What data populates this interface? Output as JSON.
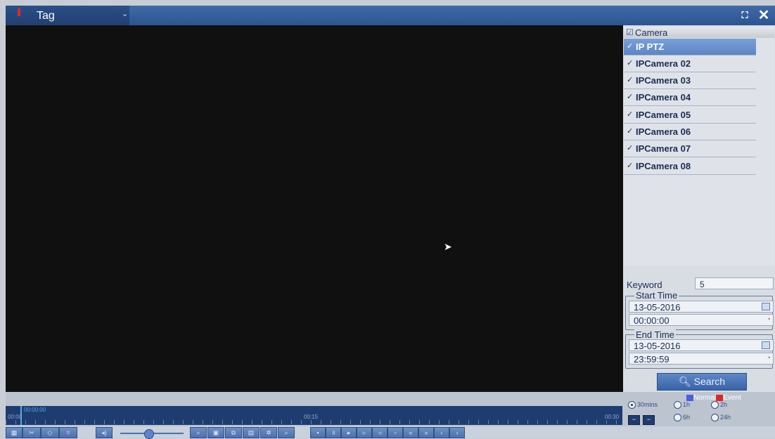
{
  "header": {
    "mode_label": "Tag",
    "fullscreen_icon": "fullscreen-icon",
    "close_icon": "close-icon"
  },
  "camera_list": {
    "header_label": "Camera",
    "items": [
      {
        "label": "IP PTZ",
        "checked": true,
        "selected": true
      },
      {
        "label": "IPCamera 02",
        "checked": true,
        "selected": false
      },
      {
        "label": "IPCamera 03",
        "checked": true,
        "selected": false
      },
      {
        "label": "IPCamera 04",
        "checked": true,
        "selected": false
      },
      {
        "label": "IPCamera 05",
        "checked": true,
        "selected": false
      },
      {
        "label": "IPCamera 06",
        "checked": true,
        "selected": false
      },
      {
        "label": "IPCamera 07",
        "checked": true,
        "selected": false
      },
      {
        "label": "IPCamera 08",
        "checked": true,
        "selected": false
      }
    ]
  },
  "search_panel": {
    "keyword_label": "Keyword",
    "keyword_value": "5",
    "start_time_label": "Start Time",
    "start_date": "13-05-2016",
    "start_time": "00:00:00",
    "end_time_label": "End Time",
    "end_date": "13-05-2016",
    "end_time": "23:59:59",
    "search_button": "Search"
  },
  "legend": {
    "normal_label": "Normal",
    "event_label": "Event",
    "normal_color": "#4a5fe0",
    "event_color": "#e02424"
  },
  "timeline": {
    "current_time": "00:00:00",
    "start_label": "00:00",
    "mid_label": "00:15",
    "end_label": "00:30"
  },
  "zoom_options": {
    "options": [
      "30mins",
      "1h",
      "2h",
      "6h",
      "24h"
    ],
    "selected": "30mins"
  }
}
